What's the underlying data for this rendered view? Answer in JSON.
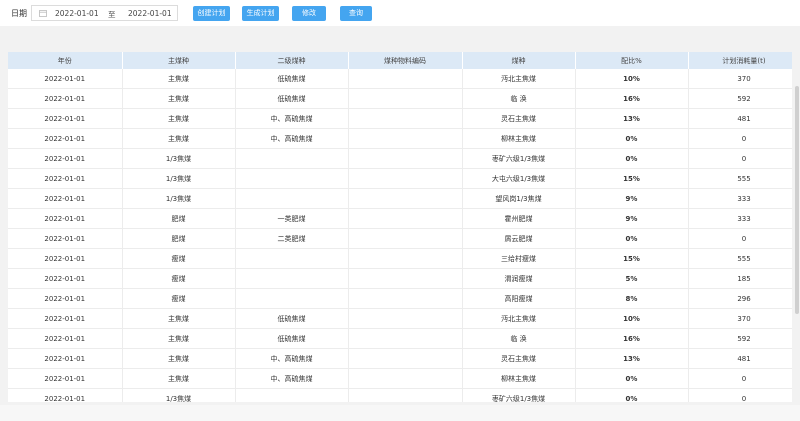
{
  "toolbar": {
    "date_label": "日期",
    "date_from": "2022-01-01",
    "date_sep": "至",
    "date_to": "2022-01-01",
    "buttons": {
      "create": "创建计划",
      "generate": "生成计划",
      "edit": "修改",
      "query": "查询"
    }
  },
  "table": {
    "columns": [
      "年份",
      "主煤种",
      "二级煤种",
      "煤种物料编码",
      "煤种",
      "配比%",
      "计划消耗量(t)"
    ],
    "rows": [
      [
        "2022-01-01",
        "主焦煤",
        "低硫焦煤",
        "",
        "沔北主焦煤",
        "10%",
        "370"
      ],
      [
        "2022-01-01",
        "主焦煤",
        "低硫焦煤",
        "",
        "临 涣",
        "16%",
        "592"
      ],
      [
        "2022-01-01",
        "主焦煤",
        "中、高硫焦煤",
        "",
        "灵石主焦煤",
        "13%",
        "481"
      ],
      [
        "2022-01-01",
        "主焦煤",
        "中、高硫焦煤",
        "",
        "柳林主焦煤",
        "0%",
        "0"
      ],
      [
        "2022-01-01",
        "1/3焦煤",
        "",
        "",
        "枣矿六级1/3焦煤",
        "0%",
        "0"
      ],
      [
        "2022-01-01",
        "1/3焦煤",
        "",
        "",
        "大屯六级1/3焦煤",
        "15%",
        "555"
      ],
      [
        "2022-01-01",
        "1/3焦煤",
        "",
        "",
        "望风岗1/3焦煤",
        "9%",
        "333"
      ],
      [
        "2022-01-01",
        "肥煤",
        "一类肥煤",
        "",
        "霍州肥煤",
        "9%",
        "333"
      ],
      [
        "2022-01-01",
        "肥煤",
        "二类肥煤",
        "",
        "屑云肥煤",
        "0%",
        "0"
      ],
      [
        "2022-01-01",
        "瘦煤",
        "",
        "",
        "三给村瘦煤",
        "15%",
        "555"
      ],
      [
        "2022-01-01",
        "瘦煤",
        "",
        "",
        "渭润瘦煤",
        "5%",
        "185"
      ],
      [
        "2022-01-01",
        "瘦煤",
        "",
        "",
        "高阳瘦煤",
        "8%",
        "296"
      ],
      [
        "2022-01-01",
        "主焦煤",
        "低硫焦煤",
        "",
        "沔北主焦煤",
        "10%",
        "370"
      ],
      [
        "2022-01-01",
        "主焦煤",
        "低硫焦煤",
        "",
        "临 涣",
        "16%",
        "592"
      ],
      [
        "2022-01-01",
        "主焦煤",
        "中、高硫焦煤",
        "",
        "灵石主焦煤",
        "13%",
        "481"
      ],
      [
        "2022-01-01",
        "主焦煤",
        "中、高硫焦煤",
        "",
        "柳林主焦煤",
        "0%",
        "0"
      ],
      [
        "2022-01-01",
        "1/3焦煤",
        "",
        "",
        "枣矿六级1/3焦煤",
        "0%",
        "0"
      ]
    ]
  }
}
